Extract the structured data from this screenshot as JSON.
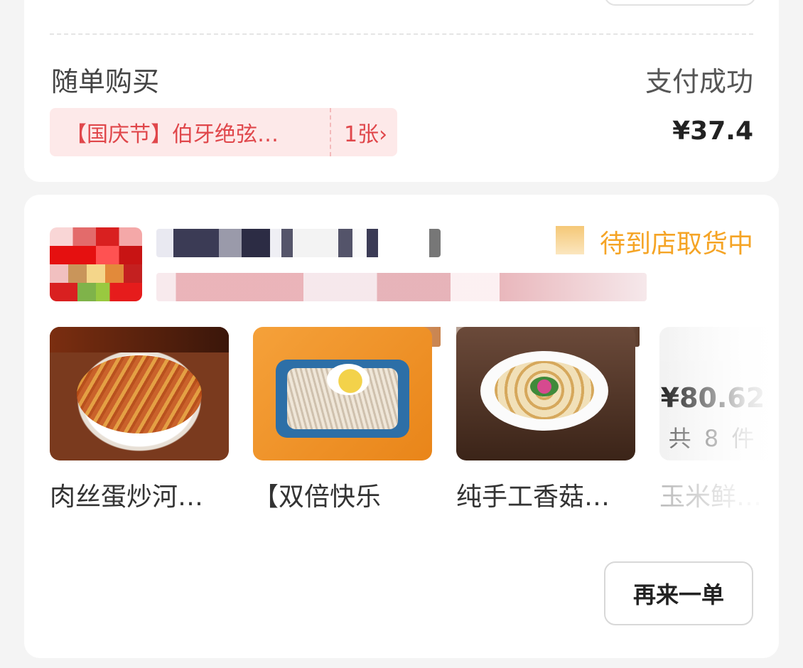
{
  "order_summary": {
    "label": "随单购买",
    "status": "支付成功",
    "coupon": {
      "name": "【国庆节】伯牙绝弦…",
      "count": "1张",
      "chevron": "chevron-right-icon"
    },
    "price": "¥37.4"
  },
  "order": {
    "store_status": "待到店取货中",
    "products": [
      {
        "name": "肉丝蛋炒河…",
        "image": "stir-fried-noodles"
      },
      {
        "name": "【双倍快乐",
        "image": "vermicelli-with-egg"
      },
      {
        "name": "纯手工香菇…",
        "image": "dumplings"
      }
    ],
    "total": {
      "price": "¥80.62",
      "count": "共 8 件",
      "hidden_item_name": "玉米鲜肉…"
    },
    "reorder_label": "再来一单"
  },
  "colors": {
    "accent_red": "#e0474b",
    "coupon_bg": "#fde9e9",
    "status_orange": "#f5a425"
  }
}
